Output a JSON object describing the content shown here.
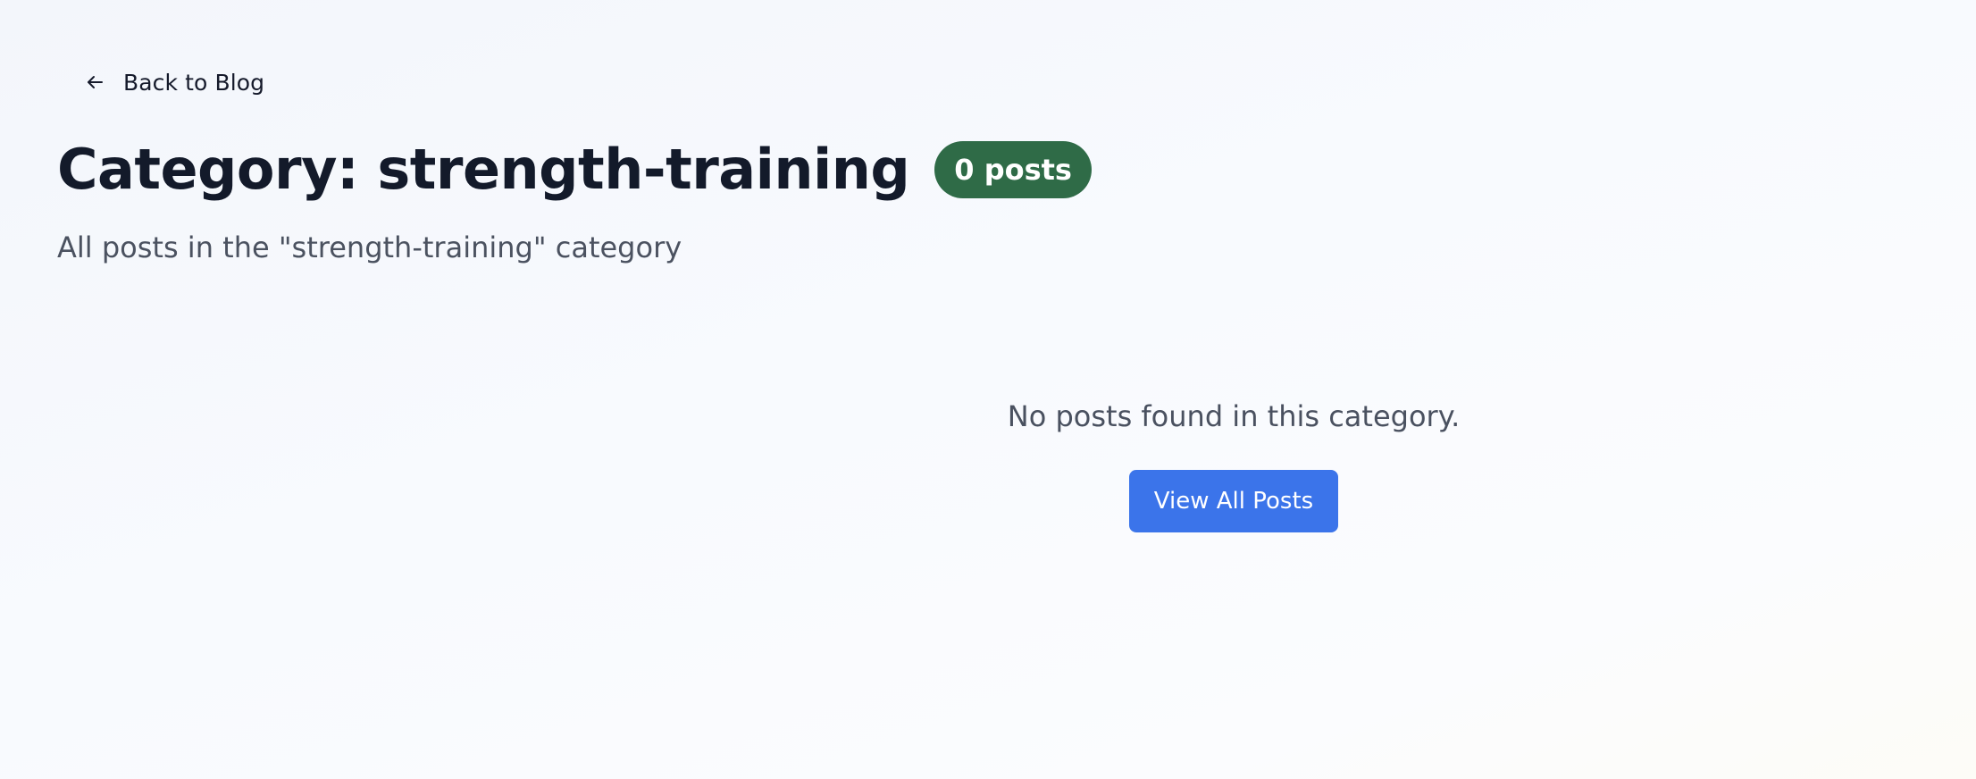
{
  "nav": {
    "back_label": "Back to Blog",
    "back_icon": "arrow-left-icon"
  },
  "header": {
    "title": "Category: strength-training",
    "post_count_badge": "0 posts",
    "subtitle": "All posts in the \"strength-training\" category"
  },
  "empty_state": {
    "message": "No posts found in this category.",
    "button_label": "View All Posts"
  },
  "colors": {
    "badge_bg": "#2f6b47",
    "button_bg": "#3b74ea",
    "text_dark": "#131a2a",
    "text_muted": "#4b5260"
  }
}
